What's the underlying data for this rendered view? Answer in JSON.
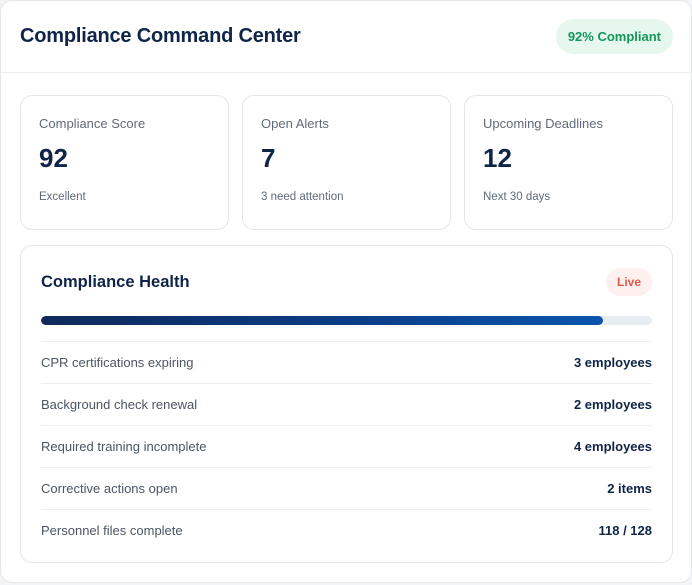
{
  "header": {
    "title": "Compliance Command Center",
    "status_badge": "92% Compliant"
  },
  "stats": [
    {
      "label": "Compliance Score",
      "value": "92",
      "sub": "Excellent"
    },
    {
      "label": "Open Alerts",
      "value": "7",
      "sub": "3 need attention"
    },
    {
      "label": "Upcoming Deadlines",
      "value": "12",
      "sub": "Next 30 days"
    }
  ],
  "health": {
    "title": "Compliance Health",
    "badge": "Live",
    "progress_percent": 92,
    "rows": [
      {
        "label": "CPR certifications expiring",
        "value": "3 employees"
      },
      {
        "label": "Background check renewal",
        "value": "2 employees"
      },
      {
        "label": "Required training incomplete",
        "value": "4 employees"
      },
      {
        "label": "Corrective actions open",
        "value": "2 items"
      },
      {
        "label": "Personnel files complete",
        "value": "118 / 128"
      }
    ]
  },
  "colors": {
    "primary_text": "#0f2447",
    "success": "#15965a",
    "success_bg": "#e6f7ee",
    "live": "#e2574c",
    "live_bg": "#fdf0ee",
    "progress_start": "#0f2a5a",
    "progress_end": "#0b55ad"
  }
}
